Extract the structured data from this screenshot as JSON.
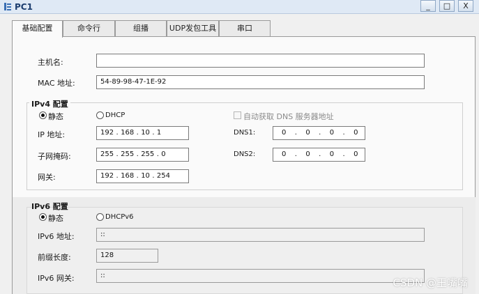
{
  "window": {
    "title": "PC1",
    "controls": {
      "minimize": "_",
      "maximize": "□",
      "close": "X"
    }
  },
  "tabs": [
    {
      "label": "基础配置",
      "active": true
    },
    {
      "label": "命令行",
      "active": false
    },
    {
      "label": "组播",
      "active": false
    },
    {
      "label": "UDP发包工具",
      "active": false
    },
    {
      "label": "串口",
      "active": false
    }
  ],
  "basic": {
    "hostname_label": "主机名:",
    "hostname_value": "",
    "mac_label": "MAC 地址:",
    "mac_value": "54-89-98-47-1E-92"
  },
  "ipv4": {
    "group_title": "IPv4 配置",
    "static_label": "静态",
    "dhcp_label": "DHCP",
    "mode": "static",
    "auto_dns_label": "自动获取 DNS 服务器地址",
    "auto_dns_checked": false,
    "ip_label": "IP 地址:",
    "ip": [
      "192",
      "168",
      "10",
      "1"
    ],
    "mask_label": "子网掩码:",
    "mask": [
      "255",
      "255",
      "255",
      "0"
    ],
    "gateway_label": "网关:",
    "gateway": [
      "192",
      "168",
      "10",
      "254"
    ],
    "dns1_label": "DNS1:",
    "dns1": [
      "0",
      "0",
      "0",
      "0"
    ],
    "dns2_label": "DNS2:",
    "dns2": [
      "0",
      "0",
      "0",
      "0"
    ]
  },
  "ipv6": {
    "group_title": "IPv6 配置",
    "static_label": "静态",
    "dhcp_label": "DHCPv6",
    "mode": "static",
    "address_label": "IPv6 地址:",
    "address_value": "::",
    "prefix_label": "前缀长度:",
    "prefix_value": "128",
    "gateway_label": "IPv6 网关:",
    "gateway_value": "::"
  },
  "watermark": "CSDN @王嘴嘴"
}
